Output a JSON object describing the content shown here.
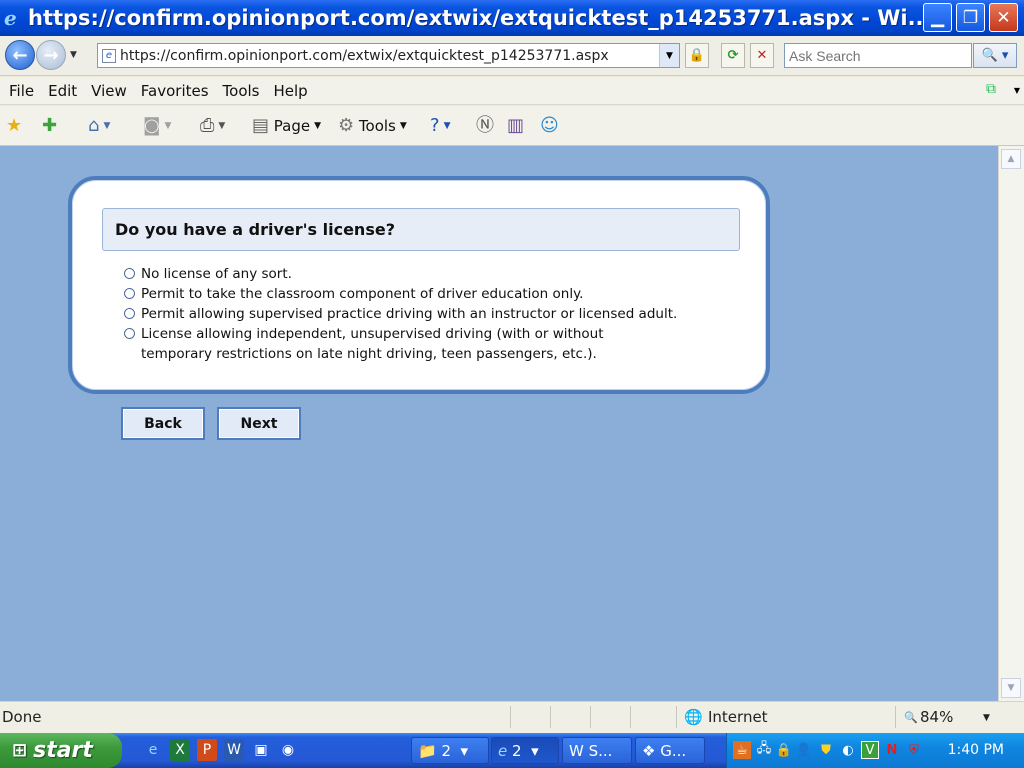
{
  "window": {
    "title": "https://confirm.opinionport.com/extwix/extquicktest_p14253771.aspx - Wi...",
    "minimize": "▁",
    "restore": "❐",
    "close": "✕"
  },
  "address_bar": {
    "url": "https://confirm.opinionport.com/extwix/extquicktest_p14253771.aspx",
    "search_placeholder": "Ask Search"
  },
  "menu": {
    "items": [
      "File",
      "Edit",
      "View",
      "Favorites",
      "Tools",
      "Help"
    ]
  },
  "command_bar": {
    "page_label": "Page",
    "tools_label": "Tools"
  },
  "survey": {
    "question": "Do you have a driver's license?",
    "options": [
      "No license of any sort.",
      "Permit to take the classroom component of driver education only.",
      "Permit allowing supervised practice driving with an instructor or licensed adult.",
      "License allowing independent, unsupervised driving (with or without temporary restrictions on late night driving, teen passengers, etc.)."
    ],
    "back_label": "Back",
    "next_label": "Next"
  },
  "status_bar": {
    "status": "Done",
    "zone": "Internet",
    "zoom": "84%"
  },
  "taskbar": {
    "start_label": "start",
    "groups": [
      {
        "label": "2"
      },
      {
        "label": "2"
      },
      {
        "label": "S..."
      },
      {
        "label": "G..."
      }
    ],
    "clock": "1:40 PM"
  }
}
